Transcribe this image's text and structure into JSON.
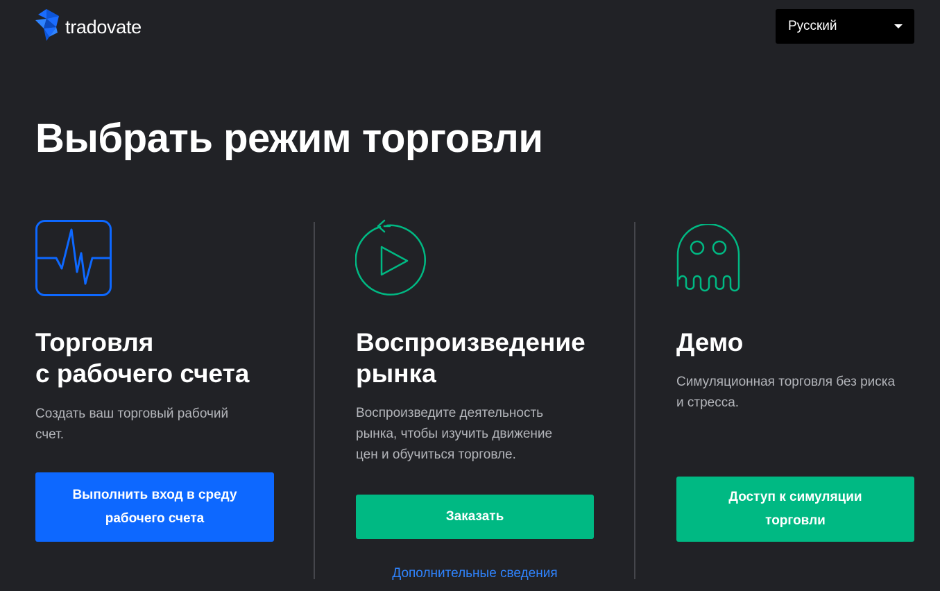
{
  "header": {
    "logo_text": "tradovate",
    "language": {
      "selected": "Русский"
    }
  },
  "page_title": "Выбрать режим торговли",
  "columns": [
    {
      "icon": "heartbeat-monitor-icon",
      "title_line1": "Торговля",
      "title_line2": "с рабочего счета",
      "desc_line1": "Создать ваш торговый рабочий",
      "desc_line2": "счет.",
      "button_line1": "Выполнить вход в среду",
      "button_line2": "рабочего счета"
    },
    {
      "icon": "replay-play-icon",
      "title_line1": "Воспроизведение",
      "title_line2": "рынка",
      "desc_line1": "Воспроизведите деятельность",
      "desc_line2": "рынка, чтобы изучить движение",
      "desc_line3": "цен и обучиться торговле.",
      "button_label": "Заказать",
      "link_label": "Дополнительные сведения"
    },
    {
      "icon": "ghost-icon",
      "title": "Демо",
      "desc_line1": "Симуляционная торговля без риска",
      "desc_line2": "и стресса.",
      "button_line1": "Доступ к симуляции",
      "button_line2": "торговли"
    }
  ],
  "colors": {
    "background": "#212226",
    "blue_accent": "#0d68ff",
    "green_accent": "#00b983",
    "link": "#2f84ff"
  }
}
